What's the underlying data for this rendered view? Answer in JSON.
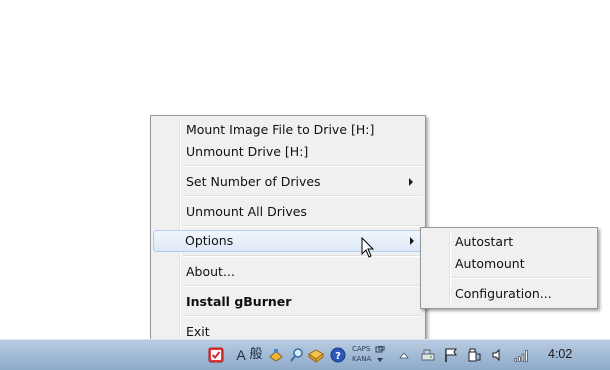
{
  "main_menu": {
    "items": [
      {
        "label": "Mount Image File to Drive [H:]"
      },
      {
        "label": "Unmount Drive [H:]"
      },
      {
        "label": "Set Number of Drives"
      },
      {
        "label": "Unmount All Drives"
      },
      {
        "label": "Options"
      },
      {
        "label": "About..."
      },
      {
        "label": "Install gBurner"
      },
      {
        "label": "Exit"
      }
    ]
  },
  "options_submenu": {
    "items": [
      {
        "label": "Autostart"
      },
      {
        "label": "Automount"
      },
      {
        "label": "Configuration..."
      }
    ]
  },
  "taskbar": {
    "ime_mode": "A",
    "ime_kanji": "般",
    "caps_label": "CAPS",
    "kana_label": "KANA",
    "clock": "4:02"
  },
  "icons": [
    "gburner-tray-icon",
    "ime-input-mode-icon",
    "ime-kanji-icon",
    "ime-tool-icon",
    "ime-search-icon",
    "ime-pad-icon",
    "help-icon",
    "caps-kana-indicator",
    "show-hidden-icons-icon",
    "network-drive-icon",
    "action-center-flag-icon",
    "safely-remove-hardware-icon",
    "volume-icon",
    "network-signal-icon"
  ]
}
